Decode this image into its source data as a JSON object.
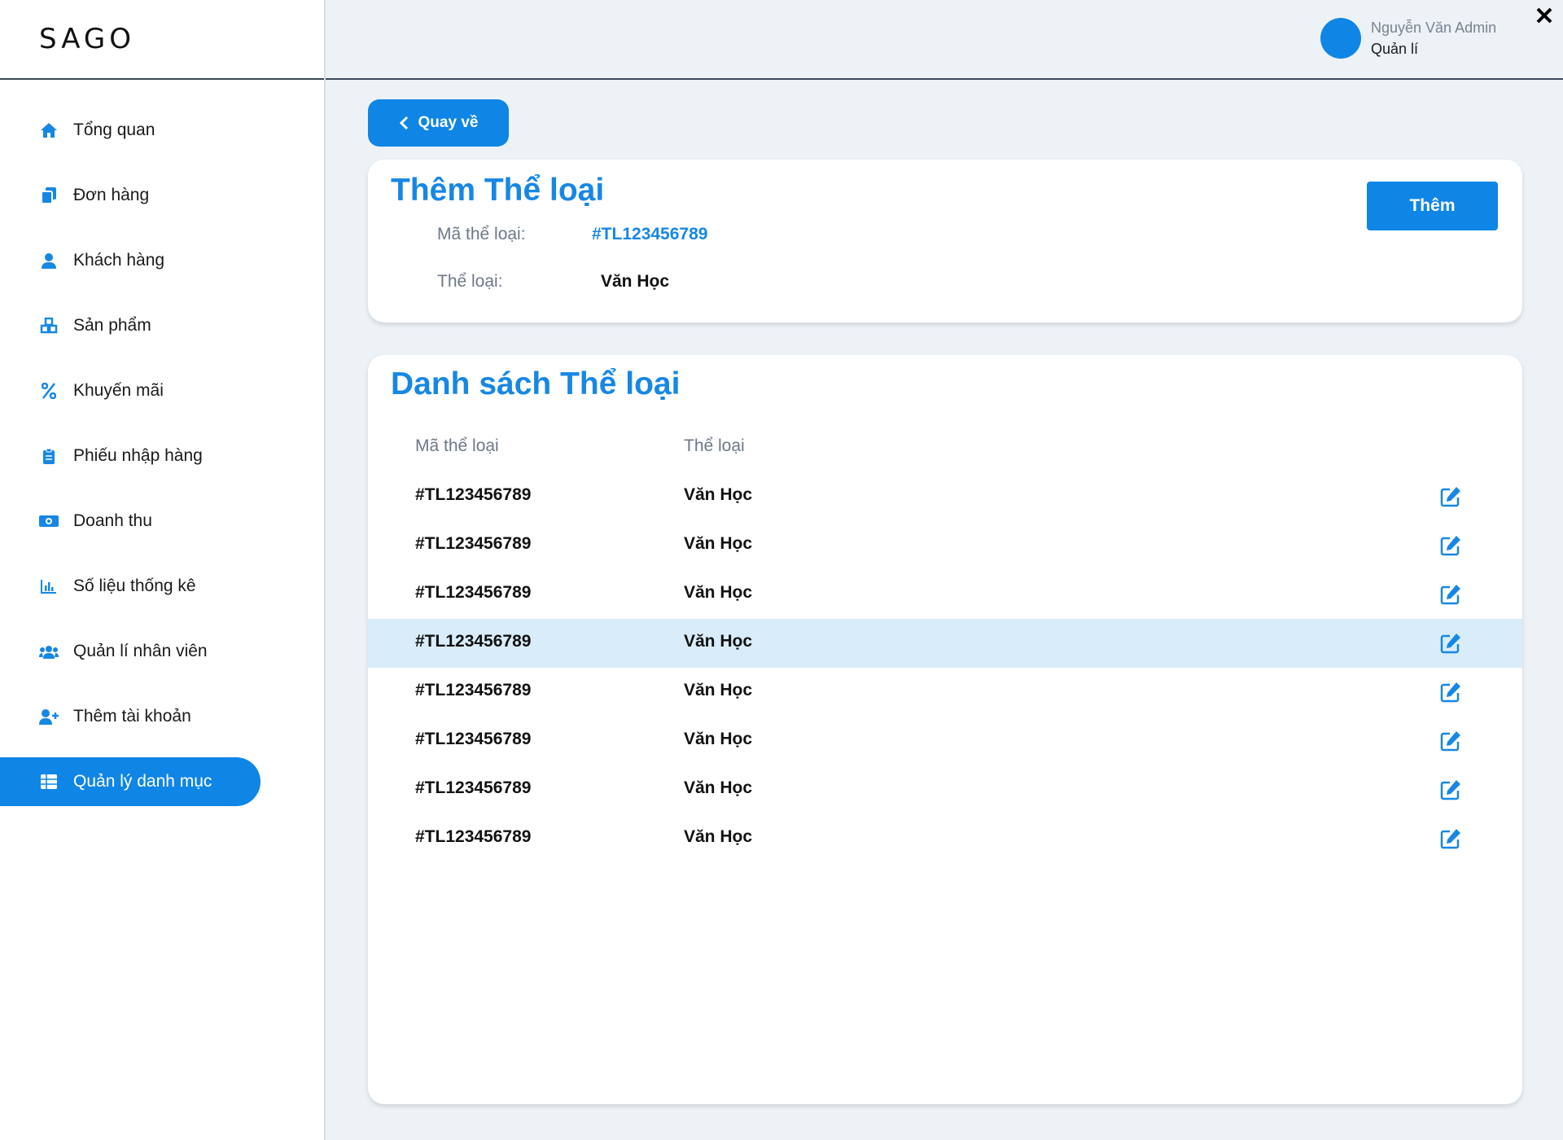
{
  "brand": {
    "logo": "SAGO",
    "accent": "#0f85e6"
  },
  "user": {
    "name": "Nguyễn Văn Admin",
    "role": "Quản lí"
  },
  "close_label": "✕",
  "sidebar": {
    "items": [
      {
        "label": "Tổng quan",
        "icon": "home-icon"
      },
      {
        "label": "Đơn hàng",
        "icon": "copy-icon"
      },
      {
        "label": "Khách hàng",
        "icon": "user-icon"
      },
      {
        "label": "Sản phẩm",
        "icon": "cubes-icon"
      },
      {
        "label": "Khuyến mãi",
        "icon": "percent-icon"
      },
      {
        "label": "Phiếu nhập hàng",
        "icon": "clipboard-icon"
      },
      {
        "label": "Doanh thu",
        "icon": "money-icon"
      },
      {
        "label": "Số liệu thống kê",
        "icon": "bar-chart-icon"
      },
      {
        "label": "Quản lí nhân viên",
        "icon": "users-icon"
      },
      {
        "label": "Thêm tài khoản",
        "icon": "user-plus-icon"
      },
      {
        "label": "Quản lý danh mục",
        "icon": "table-icon",
        "active": true
      }
    ]
  },
  "back_button": {
    "label": "Quay về"
  },
  "add_form": {
    "title": "Thêm Thể loại",
    "code_label": "Mã thể loại:",
    "code_value": "#TL123456789",
    "code_color": "#1787e4",
    "name_label": "Thể loại:",
    "name_value": "Văn Học",
    "submit_label": "Thêm"
  },
  "list": {
    "title": "Danh sách Thể loại",
    "columns": [
      "Mã thể loại",
      "Thể loại"
    ],
    "rows": [
      {
        "code": "#TL123456789",
        "name": "Văn Học"
      },
      {
        "code": "#TL123456789",
        "name": "Văn Học"
      },
      {
        "code": "#TL123456789",
        "name": "Văn Học"
      },
      {
        "code": "#TL123456789",
        "name": "Văn Học",
        "highlighted": true
      },
      {
        "code": "#TL123456789",
        "name": "Văn Học"
      },
      {
        "code": "#TL123456789",
        "name": "Văn Học"
      },
      {
        "code": "#TL123456789",
        "name": "Văn Học"
      },
      {
        "code": "#TL123456789",
        "name": "Văn Học"
      }
    ]
  }
}
